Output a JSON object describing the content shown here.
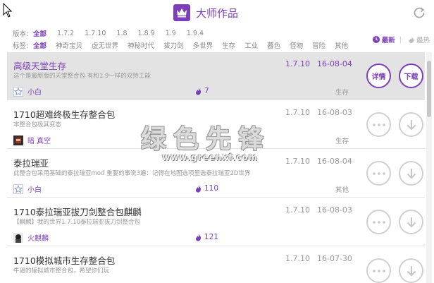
{
  "header": {
    "title": "大师作品"
  },
  "filters": {
    "version_label": "版本:",
    "versions": [
      "全部",
      "1.7.2",
      "1.7.10",
      "1.8",
      "1.8.9",
      "1.9",
      "1.9.4"
    ],
    "tag_label": "标签:",
    "tags": [
      "全部",
      "神奇宝贝",
      "虚无世界",
      "神秘时代",
      "拔刀剑",
      "多世界",
      "生存",
      "工业",
      "暮色",
      "怪物",
      "冒险",
      "其他"
    ]
  },
  "sort": {
    "newest": "最新",
    "hot": "最热"
  },
  "items": [
    {
      "name": "高级天堂生存",
      "desc": "这个是最新版的天堂整合包 有和1.9一样的双持工能",
      "version": "1.7.10",
      "date": "16-08-04",
      "author": "小白",
      "likes": "7",
      "tag": "生存",
      "btn_detail": "详情",
      "btn_download": "下载"
    },
    {
      "name": "1710超难终极生存整合包",
      "desc": "本整合包极其变态",
      "version": "1.7.10",
      "date": "16-08-03",
      "author": "暗 真空",
      "likes": "",
      "tag": "生存"
    },
    {
      "name": "泰拉瑞亚",
      "desc": "此整合包采用基础的泰拉瑞亚mod 重要的事说3遍：记得在地图选项里选泰拉瑞亚2D世界",
      "version": "1.7.10",
      "date": "16-08-04",
      "author": "小白",
      "likes": "110",
      "tag": "其他"
    },
    {
      "name": "1710泰拉瑞亚拔刀剑整合包麒麟",
      "desc": "【麒麟】我的世界1.7.10泰拉瑞亚拔刀剑整合包",
      "version": "1.7.10",
      "date": "16-08-03",
      "author": "火麒麟",
      "likes": "121",
      "tag": ""
    },
    {
      "name": "1710模拟城市生存整合包",
      "desc": "牛逼的模拟城市整合包，希望你们玩",
      "version": "1.7.10",
      "date": "16-07-30",
      "author": "",
      "likes": "",
      "tag": ""
    }
  ],
  "watermark": {
    "text": "绿色先锋",
    "url": "www.greenxf.com"
  },
  "colors": {
    "accent": "#7b3fb7",
    "selected_bg": "#e3e3e3",
    "muted": "#999999"
  }
}
